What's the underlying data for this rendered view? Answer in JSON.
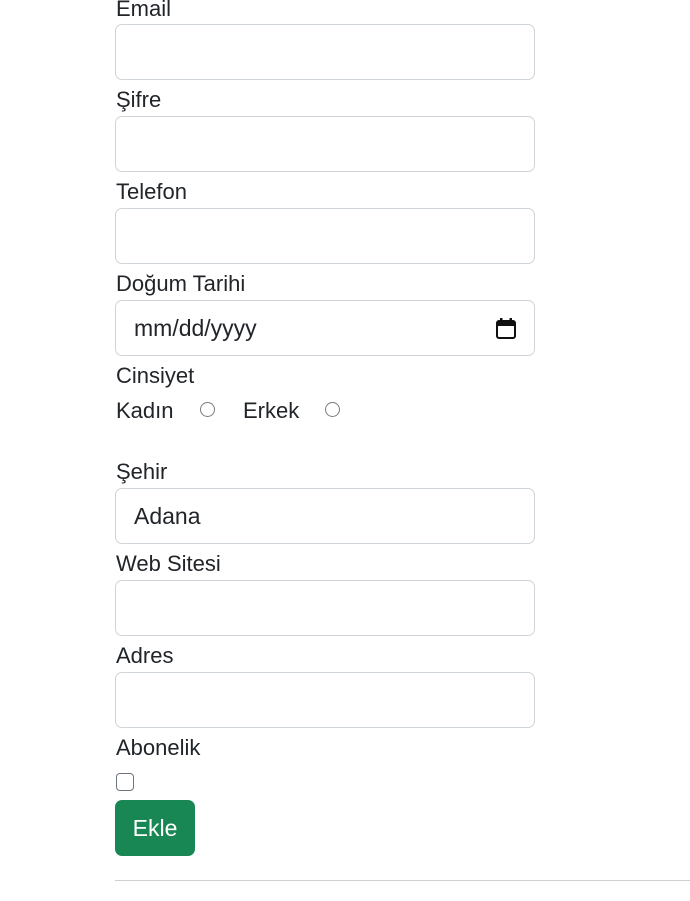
{
  "form": {
    "email_label": "Email",
    "password_label": "Şifre",
    "phone_label": "Telefon",
    "birthdate_label": "Doğum Tarihi",
    "birthdate_placeholder": "mm/dd/yyyy",
    "gender_label": "Cinsiyet",
    "gender_options": [
      "Kadın",
      "Erkek"
    ],
    "city_label": "Şehir",
    "city_value": "Adana",
    "website_label": "Web Sitesi",
    "address_label": "Adres",
    "subscription_label": "Abonelik",
    "submit_label": "Ekle"
  },
  "colors": {
    "submit_button": "#198754",
    "input_border": "#ced4da",
    "text": "#212529"
  },
  "icons": {
    "date_picker": "calendar-icon"
  }
}
